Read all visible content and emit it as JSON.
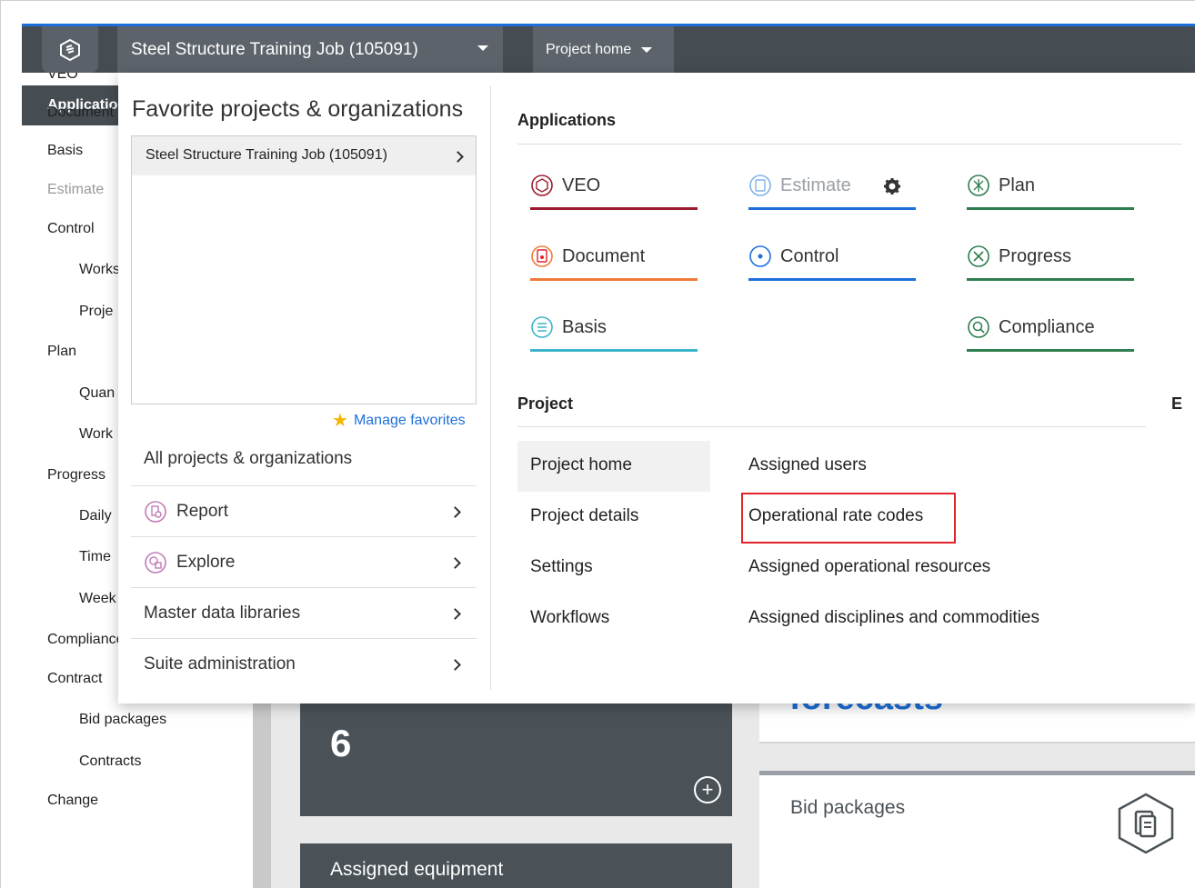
{
  "topbar": {
    "job_title": "Steel Structure Training Job (105091)",
    "home_label": "Project home"
  },
  "leftnav": {
    "selected": "Applications",
    "items": [
      {
        "label": "VEO",
        "indent": 0
      },
      {
        "label": "Document",
        "indent": 0
      },
      {
        "label": "Basis",
        "indent": 0
      },
      {
        "label": "Estimate",
        "indent": 0,
        "dim": true
      },
      {
        "label": "Control",
        "indent": 0
      },
      {
        "label": "Works",
        "indent": 1
      },
      {
        "label": "Proje",
        "indent": 1
      },
      {
        "label": "Plan",
        "indent": 0
      },
      {
        "label": "Quan",
        "indent": 1
      },
      {
        "label": "Work",
        "indent": 1
      },
      {
        "label": "Progress",
        "indent": 0
      },
      {
        "label": "Daily",
        "indent": 1
      },
      {
        "label": "Time",
        "indent": 1
      },
      {
        "label": "Week",
        "indent": 1
      },
      {
        "label": "Compliance",
        "indent": 0
      },
      {
        "label": "Contract",
        "indent": 0
      },
      {
        "label": "Bid packages",
        "indent": 1
      },
      {
        "label": "Contracts",
        "indent": 1
      },
      {
        "label": "Change",
        "indent": 0
      }
    ]
  },
  "background": {
    "dark_card_value": "6",
    "dark_card2_title": "Assigned equipment",
    "white_card_text": "forecasts",
    "white_card2_title": "Bid packages"
  },
  "dropdown": {
    "favorites_title": "Favorite projects & organizations",
    "favorite_item": "Steel Structure Training Job (105091)",
    "manage_favorites": "Manage favorites",
    "all_projects": "All projects & organizations",
    "menu": {
      "report": "Report",
      "explore": "Explore",
      "master_data": "Master data libraries",
      "suite_admin": "Suite administration"
    },
    "applications_heading": "Applications",
    "apps": {
      "veo": {
        "label": "VEO",
        "color": "#9b1c2e"
      },
      "estimate": {
        "label": "Estimate",
        "color": "#1e6fd9"
      },
      "plan": {
        "label": "Plan",
        "color": "#2e7d4f"
      },
      "document": {
        "label": "Document",
        "color": "#f07a3a"
      },
      "control": {
        "label": "Control",
        "color": "#1e6fd9"
      },
      "progress": {
        "label": "Progress",
        "color": "#2e7d4f"
      },
      "basis": {
        "label": "Basis",
        "color": "#3bb3c9"
      },
      "compliance": {
        "label": "Compliance",
        "color": "#2e7d4f"
      }
    },
    "project_heading": "Project",
    "project_col1": [
      "Project home",
      "Project details",
      "Settings",
      "Workflows"
    ],
    "project_col2": [
      "Assigned users",
      "Operational rate codes",
      "Assigned operational resources",
      "Assigned disciplines and commodities"
    ],
    "extra_heading": "E"
  }
}
